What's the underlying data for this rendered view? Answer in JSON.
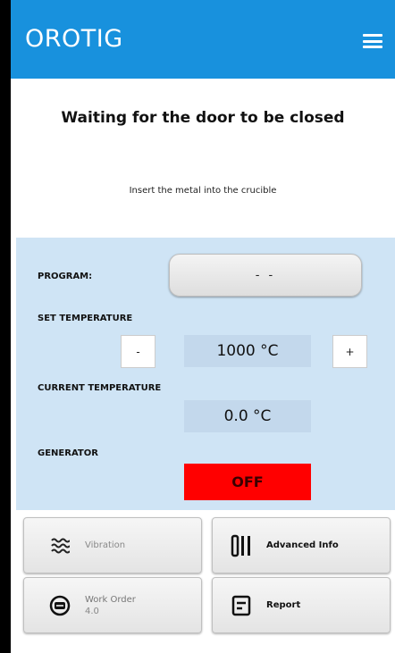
{
  "header": {
    "brand": "OROTIG",
    "menu_icon": "hamburger-menu-icon"
  },
  "status": {
    "title": "Waiting for the door to be closed",
    "message": "Insert the metal into the crucible"
  },
  "panel": {
    "program_label": "PROGRAM:",
    "program_value": "- -",
    "set_temp_label": "SET TEMPERATURE",
    "set_temp_value": "1000 °C",
    "minus_label": "-",
    "plus_label": "+",
    "current_temp_label": "CURRENT TEMPERATURE",
    "current_temp_value": "0.0 °C",
    "generator_label": "GENERATOR",
    "generator_value": "OFF",
    "generator_color": "#ff0000",
    "panel_color": "#cfe4f5"
  },
  "actions": {
    "vibration": {
      "label": "Vibration",
      "icon": "vibration-waves-icon"
    },
    "advanced_info": {
      "label": "Advanced Info",
      "icon": "bar-chart-icon"
    },
    "work_order": {
      "label": "Work Order",
      "sub": "4.0",
      "icon": "work-order-icon"
    },
    "report": {
      "label": "Report",
      "icon": "report-document-icon"
    }
  },
  "colors": {
    "header": "#1891dd"
  }
}
